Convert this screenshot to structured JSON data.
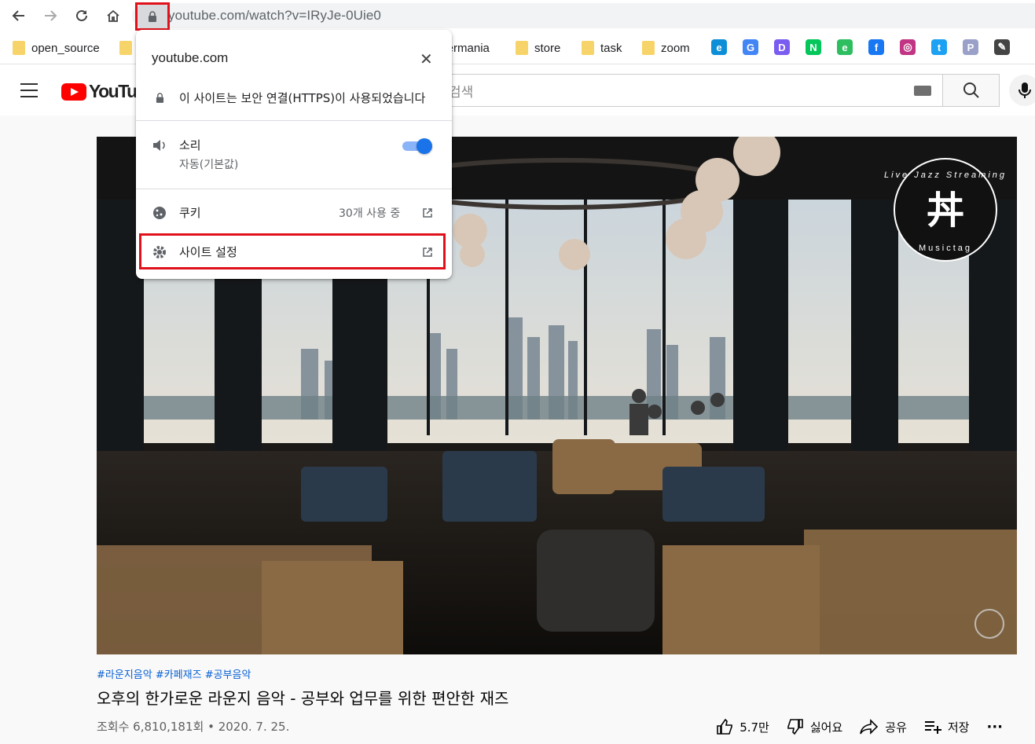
{
  "browser": {
    "url": "youtube.com/watch?v=IRyJe-0Uie0",
    "nav": [
      "back-icon",
      "forward-icon",
      "reload-icon",
      "home-icon"
    ]
  },
  "bookmarks": {
    "folders": [
      {
        "label": "open_source"
      },
      {
        "label": "ppermania"
      },
      {
        "label": "store"
      },
      {
        "label": "task"
      },
      {
        "label": "zoom"
      }
    ],
    "icons": [
      {
        "name": "edge-icon",
        "glyph": "e",
        "color": "#0c8fd6"
      },
      {
        "name": "google-icon",
        "glyph": "G",
        "color": "#4285f4"
      },
      {
        "name": "d-icon",
        "glyph": "D",
        "color": "#7b5cf0"
      },
      {
        "name": "naver-icon",
        "glyph": "N",
        "color": "#03c75a"
      },
      {
        "name": "evernote-icon",
        "glyph": "e",
        "color": "#2dbe60"
      },
      {
        "name": "facebook-icon",
        "glyph": "f",
        "color": "#1877f2"
      },
      {
        "name": "instagram-icon",
        "glyph": "◎",
        "color": "#c13584"
      },
      {
        "name": "twitter-icon",
        "glyph": "t",
        "color": "#1da1f2"
      },
      {
        "name": "p-icon",
        "glyph": "P",
        "color": "#9aa0c8"
      },
      {
        "name": "pen-icon",
        "glyph": "✎",
        "color": "#444444"
      }
    ]
  },
  "youtube": {
    "logo": "YouTube",
    "search_placeholder": "검색"
  },
  "popup": {
    "host": "youtube.com",
    "close": "✕",
    "secure_text": "이 사이트는 보안 연결(HTTPS)이 사용되었습니다",
    "sound_label": "소리",
    "sound_sub": "자동(기본값)",
    "sound_enabled": true,
    "cookies_label": "쿠키",
    "cookies_count": "30개 사용 중",
    "site_settings_label": "사이트 설정"
  },
  "video": {
    "hashtags": "#라운지음악 #카페재즈 #공부음악",
    "title": "오후의 한가로운 라운지 음악 - 공부와 업무를 위한 편안한 재즈",
    "views": "조회수 6,810,181회 • 2020. 7. 25.",
    "likes": "5.7만",
    "dislike": "싫어요",
    "share": "공유",
    "save": "저장",
    "more": "···",
    "badge": {
      "top": "Live Jazz Streaming",
      "bottom": "Musictag",
      "glyph": "丼"
    }
  },
  "colors": {
    "highlight": "#e0111b",
    "link": "#065fd4",
    "toggle": "#1a73e8",
    "yt_red": "#ff0000"
  }
}
